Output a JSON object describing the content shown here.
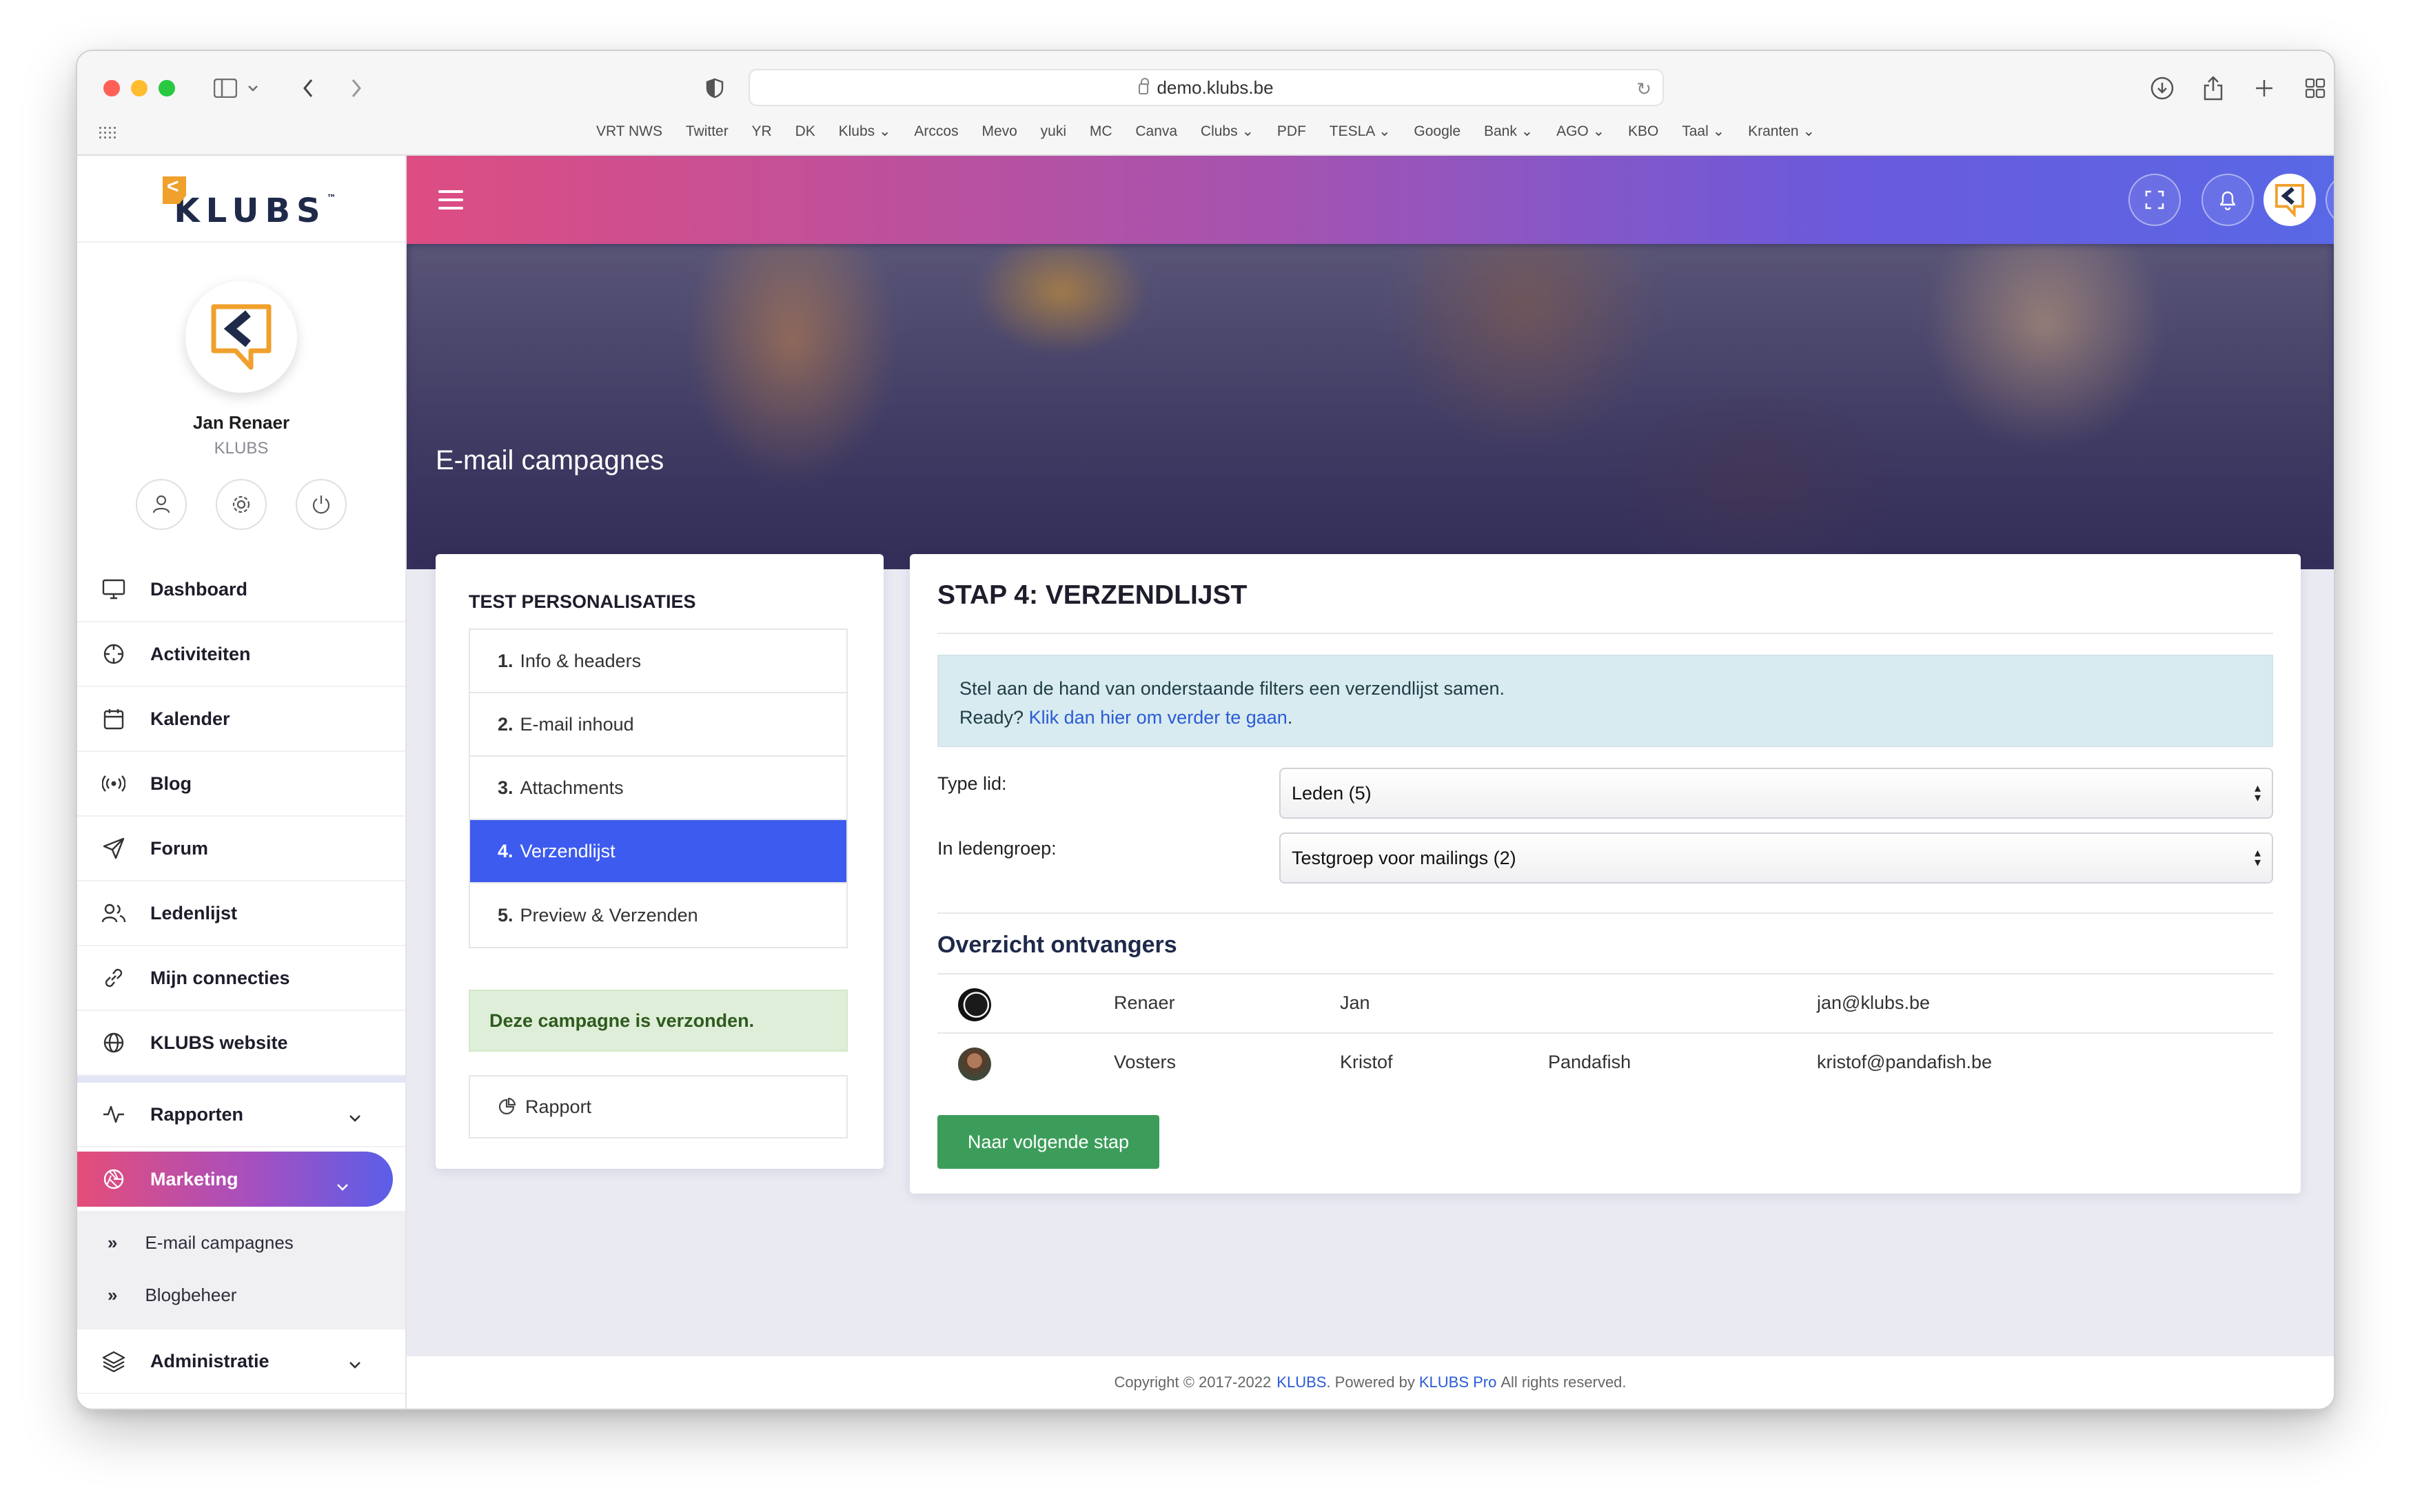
{
  "browser": {
    "url": "demo.klubs.be",
    "bookmarks": [
      "VRT NWS",
      "Twitter",
      "YR",
      "DK",
      "Klubs ⌄",
      "Arccos",
      "Mevo",
      "yuki",
      "MC",
      "Canva",
      "Clubs ⌄",
      "PDF",
      "TESLA ⌄",
      "Google",
      "Bank ⌄",
      "AGO ⌄",
      "KBO",
      "Taal ⌄",
      "Kranten ⌄"
    ]
  },
  "sidebar": {
    "brand": "KLUBS",
    "brand_tm": "™",
    "user_name": "Jan Renaer",
    "user_org": "KLUBS",
    "items": [
      {
        "label": "Dashboard",
        "icon": "monitor-icon"
      },
      {
        "label": "Activiteiten",
        "icon": "crosshair-icon"
      },
      {
        "label": "Kalender",
        "icon": "calendar-icon"
      },
      {
        "label": "Blog",
        "icon": "broadcast-icon"
      },
      {
        "label": "Forum",
        "icon": "send-icon"
      },
      {
        "label": "Ledenlijst",
        "icon": "users-icon"
      },
      {
        "label": "Mijn connecties",
        "icon": "link-icon"
      },
      {
        "label": "KLUBS website",
        "icon": "globe-icon"
      }
    ],
    "rapporten": "Rapporten",
    "marketing": "Marketing",
    "marketing_sub": [
      "E-mail campagnes",
      "Blogbeheer"
    ],
    "administratie": "Administratie"
  },
  "hero": {
    "title": "E-mail campagnes"
  },
  "steps_panel": {
    "title": "TEST PERSONALISATIES",
    "steps": [
      {
        "num": "1.",
        "label": "Info & headers"
      },
      {
        "num": "2.",
        "label": "E-mail inhoud"
      },
      {
        "num": "3.",
        "label": "Attachments"
      },
      {
        "num": "4.",
        "label": "Verzendlijst"
      },
      {
        "num": "5.",
        "label": "Preview & Verzenden"
      }
    ],
    "active_step": 4,
    "sent_message": "Deze campagne is verzonden.",
    "report_label": "Rapport"
  },
  "main": {
    "title": "STAP 4: VERZENDLIJST",
    "info_line1": "Stel aan de hand van onderstaande filters een verzendlijst samen.",
    "info_line2_prefix": "Ready?",
    "info_link": "Klik dan hier om verder te gaan",
    "info_suffix": ".",
    "type_label": "Type lid:",
    "type_value": "Leden (5)",
    "group_label": "In ledengroep:",
    "group_value": "Testgroep voor mailings (2)",
    "recipients_title": "Overzicht ontvangers",
    "recipients": [
      {
        "last": "Renaer",
        "first": "Jan",
        "company": "",
        "email": "jan@klubs.be"
      },
      {
        "last": "Vosters",
        "first": "Kristof",
        "company": "Pandafish",
        "email": "kristof@pandafish.be"
      }
    ],
    "next_button": "Naar volgende stap"
  },
  "footer": {
    "prefix": "Copyright © 2017-2022",
    "brand": "KLUBS",
    "powered": ". Powered by",
    "pro": "KLUBS Pro",
    "suffix": "All rights reserved."
  }
}
